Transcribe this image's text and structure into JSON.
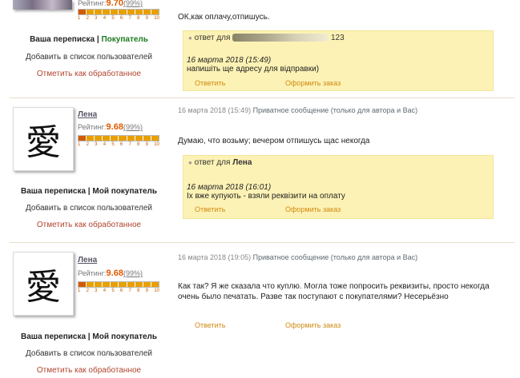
{
  "rating_label": "Рейтинг:",
  "rating_scale": [
    "1",
    "2",
    "3",
    "4",
    "5",
    "6",
    "7",
    "8",
    "9",
    "10"
  ],
  "post0": {
    "rating_value": "9.70",
    "rating_pct": "(99%)",
    "correspondence": "Ваша переписка",
    "divider": "|",
    "role": "Покупатель",
    "add_to_list": "Добавить в список пользователей",
    "mark_processed": "Отметить как обработанное",
    "message": "ОК,как оплачу,отпишусь.",
    "reply": {
      "header": "ответ для",
      "recipient_suffix": "123",
      "date": "16 марта 2018 (15:49)",
      "text": "напишіть ще адресу для відправки)",
      "reply_link": "Ответить",
      "order_link": "Оформить заказ"
    }
  },
  "post1": {
    "username": "Лена",
    "avatar_glyph": "愛",
    "rating_value": "9.68",
    "rating_pct": "(99%)",
    "correspondence": "Ваша переписка",
    "divider": "|",
    "role": "Мой покупатель",
    "add_to_list": "Добавить в список пользователей",
    "mark_processed": "Отметить как обработанное",
    "date": "16 марта 2018 (15:49)",
    "message_type": "Приватное сообщение",
    "visibility": "(только для автора и Вас)",
    "message": "Думаю, что возьму; вечером отпишусь щас некогда",
    "reply": {
      "header": "ответ для",
      "recipient": "Лена",
      "date": "16 марта 2018 (16:01)",
      "text": "Іх вже купують - взяли реквізити на оплату",
      "reply_link": "Ответить",
      "order_link": "Оформить заказ"
    }
  },
  "post2": {
    "username": "Лена",
    "avatar_glyph": "愛",
    "rating_value": "9.68",
    "rating_pct": "(99%)",
    "correspondence": "Ваша переписка",
    "divider": "|",
    "role": "Мой покупатель",
    "add_to_list": "Добавить в список пользователей",
    "mark_processed": "Отметить как обработанное",
    "date": "16 марта 2018 (19:05)",
    "message_type": "Приватное сообщение",
    "visibility": "(только для автора и Вас)",
    "message_line1": "Как так? Я же сказала что куплю. Могла тоже попросить реквизиты, просто некогда",
    "message_line2": "очень было печатать. Разве так поступают с покупателями? Несерьёзно",
    "reply_link": "Ответить",
    "order_link": "Оформить заказ"
  },
  "colors": {
    "reply_bg": "#fdf2b5",
    "rating_value": "#e05a00",
    "link": "#d08a10",
    "mark_link": "#b0442e",
    "buyer_green": "#1d7a1d"
  }
}
